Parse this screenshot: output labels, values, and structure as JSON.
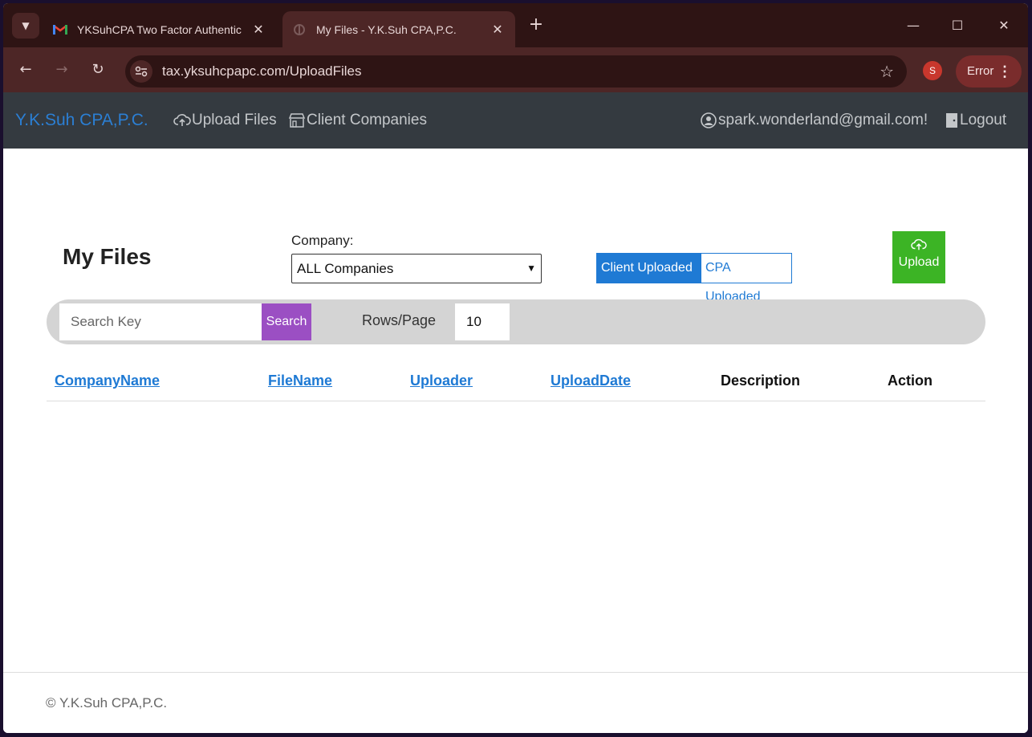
{
  "browser": {
    "tabs": [
      {
        "title": "YKSuhCPA Two Factor Authentic",
        "favicon": "gmail-icon",
        "active": false
      },
      {
        "title": "My Files - Y.K.Suh CPA,P.C.",
        "favicon": "site-icon",
        "active": true
      }
    ],
    "url": "tax.yksuhcpapc.com/UploadFiles",
    "profile_initial": "S",
    "error_label": "Error"
  },
  "navbar": {
    "brand": "Y.K.Suh CPA,P.C.",
    "upload_files": "Upload Files",
    "client_companies": "Client Companies",
    "user": "spark.wonderland@gmail.com!",
    "logout": "Logout"
  },
  "main": {
    "title": "My Files",
    "company_label": "Company:",
    "company_selected": "ALL Companies",
    "toggle_client": "Client Uploaded",
    "toggle_cpa": "CPA Uploaded",
    "upload_label": "Upload",
    "search_placeholder": "Search Key",
    "search_button": "Search",
    "rows_label": "Rows/Page",
    "rows_value": "10",
    "columns": [
      "CompanyName",
      "FileName",
      "Uploader",
      "UploadDate",
      "Description",
      "Action"
    ]
  },
  "footer": {
    "text": "© Y.K.Suh CPA,P.C."
  }
}
